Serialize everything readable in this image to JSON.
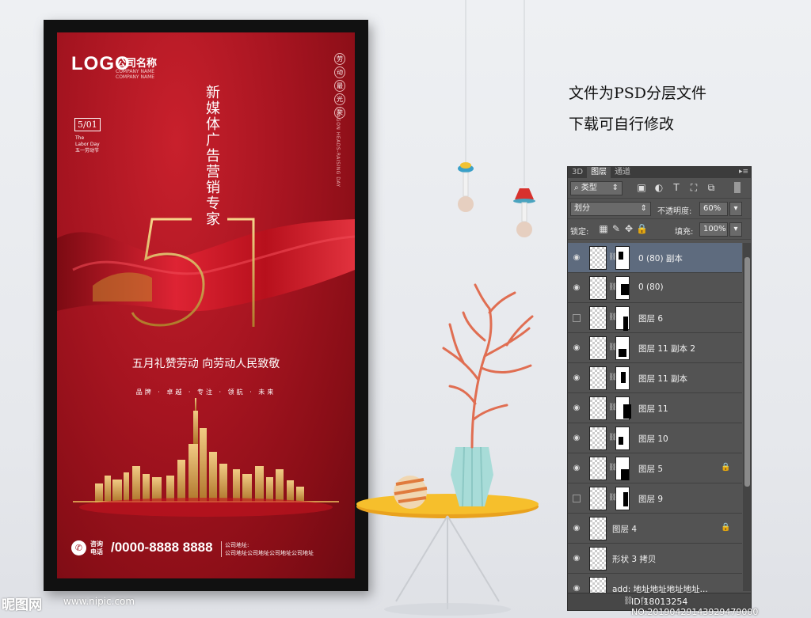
{
  "poster": {
    "logo": "LOGO",
    "company": "公司名称",
    "company_en": "COMPANY NAME",
    "company_en2": "COMPANY NAME",
    "seal": [
      "劳",
      "动",
      "最",
      "光",
      "荣"
    ],
    "dragon_text": "DRAGON HEADS-RAISING DAY",
    "date": "5/01",
    "date_en1": "The",
    "date_en2": "Labor Day",
    "date_cn": "五一劳动节",
    "big_number": "51",
    "headline": "新媒体广告营销专家",
    "slogan": "五月礼赞劳动  向劳动人民致敬",
    "tagline": "品牌 · 卓越 · 专注 · 领航 · 未来",
    "contact_label1": "咨询",
    "contact_label2": "电话",
    "phone": "/0000-8888 8888",
    "address_label": "公司地址:",
    "address": "公司地址公司地址公司地址公司地址"
  },
  "notes": {
    "line1": "文件为PSD分层文件",
    "line2": "下载可自行修改"
  },
  "layers_panel": {
    "tabs": [
      "3D",
      "图层",
      "通道"
    ],
    "active_tab": "图层",
    "filter_kind": "类型",
    "blend_mode": "划分",
    "opacity_label": "不透明度:",
    "opacity_value": "60%",
    "lock_label": "锁定:",
    "fill_label": "填充:",
    "fill_value": "100%",
    "layers": [
      {
        "name": "0 (80) 副本",
        "visible": true,
        "selected": true,
        "locked": false,
        "mask": true
      },
      {
        "name": "0 (80)",
        "visible": true,
        "selected": false,
        "locked": false,
        "mask": true
      },
      {
        "name": "图层 6",
        "visible": false,
        "selected": false,
        "locked": false,
        "mask": true
      },
      {
        "name": "图层 11 副本 2",
        "visible": true,
        "selected": false,
        "locked": false,
        "mask": true
      },
      {
        "name": "图层 11 副本",
        "visible": true,
        "selected": false,
        "locked": false,
        "mask": true
      },
      {
        "name": "图层 11",
        "visible": true,
        "selected": false,
        "locked": false,
        "mask": true
      },
      {
        "name": "图层 10",
        "visible": true,
        "selected": false,
        "locked": false,
        "mask": true
      },
      {
        "name": "图层 5",
        "visible": true,
        "selected": false,
        "locked": true,
        "mask": true
      },
      {
        "name": "图层 9",
        "visible": false,
        "selected": false,
        "locked": false,
        "mask": true
      },
      {
        "name": "图层 4",
        "visible": true,
        "selected": false,
        "locked": true,
        "mask": false
      },
      {
        "name": "形状 3 拷贝",
        "visible": true,
        "selected": false,
        "locked": false,
        "mask": false
      },
      {
        "name": "add:  地址地址地址地址...",
        "visible": true,
        "selected": false,
        "locked": false,
        "mask": false
      }
    ]
  },
  "watermark": {
    "site": "昵图网",
    "url": "www.nipic.com",
    "id": "ID:18013254 NO:20190429143929479000"
  },
  "colors": {
    "poster_red": "#a51420",
    "gold": "#d4a24a",
    "panel_bg": "#535353",
    "selected_layer": "#5e6b7e"
  }
}
